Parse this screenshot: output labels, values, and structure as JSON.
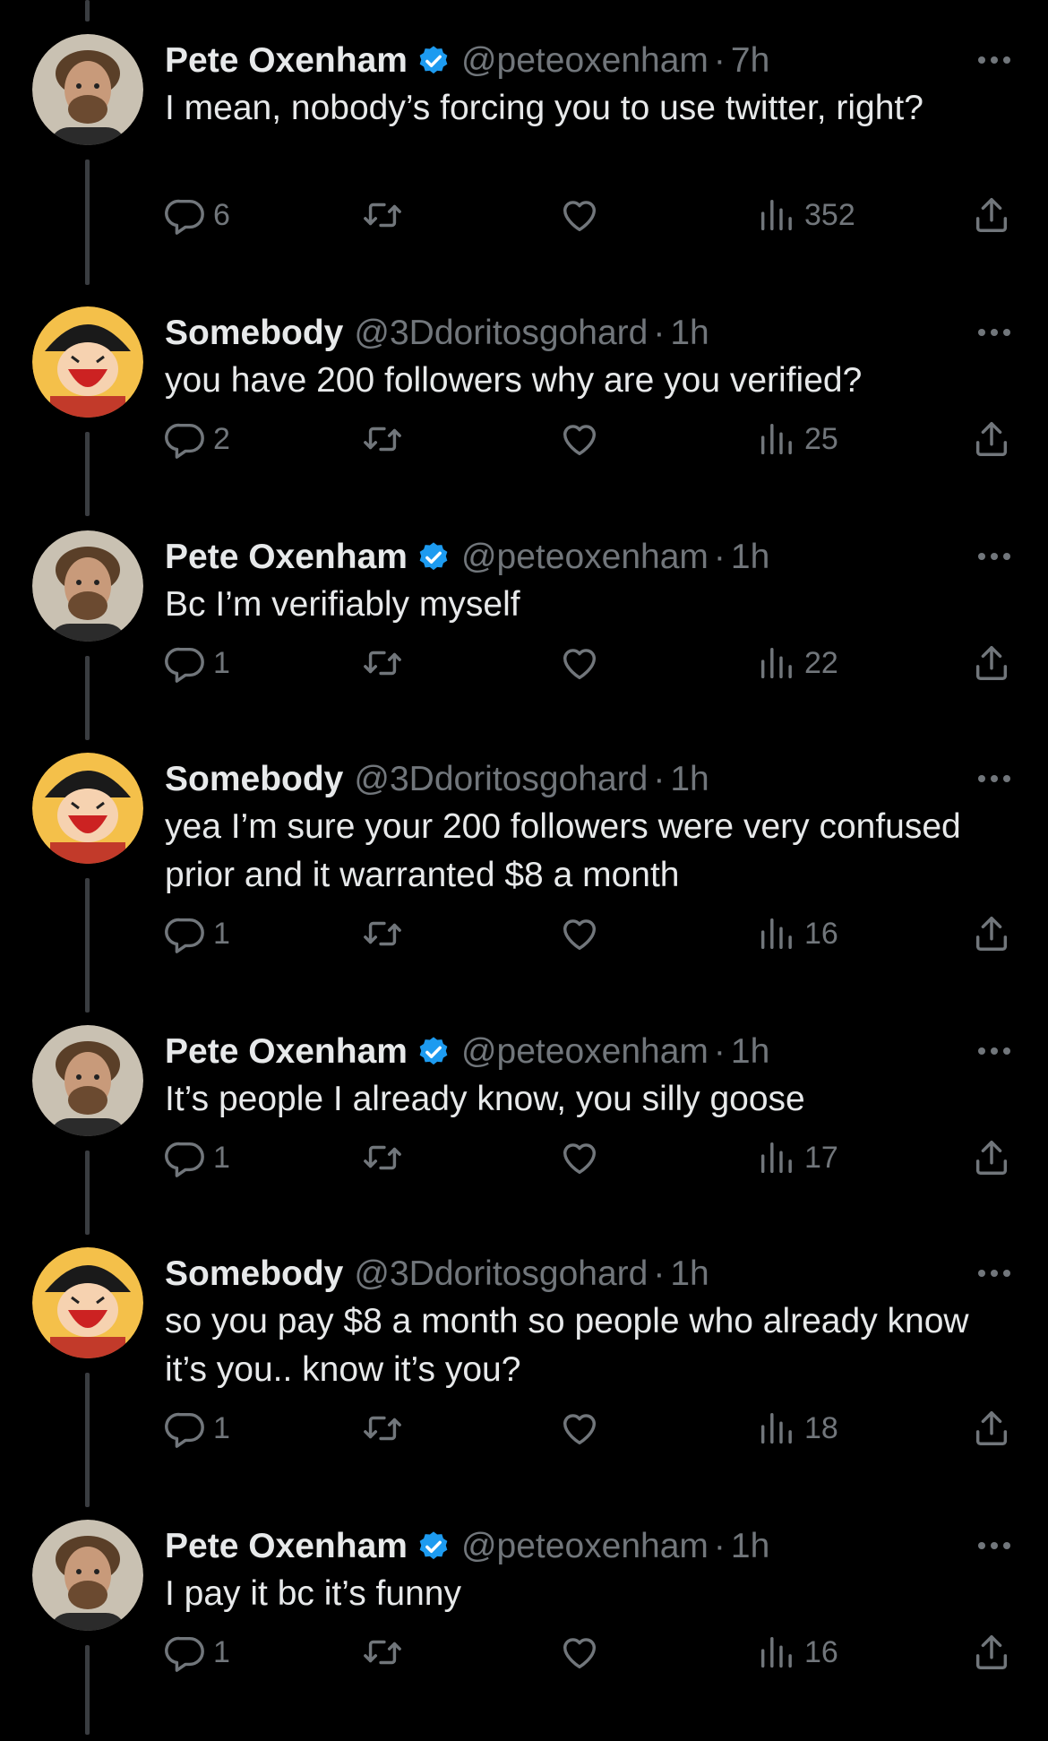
{
  "tweets": [
    {
      "name": "Pete Oxenham",
      "verified": true,
      "handle": "@peteoxenham",
      "time": "7h",
      "text": "I mean, nobody’s forcing you to use twitter, right?",
      "replies": "6",
      "views": "352",
      "avatar": "pete"
    },
    {
      "name": "Somebody",
      "verified": false,
      "handle": "@3Ddoritosgohard",
      "time": "1h",
      "text": "you have 200 followers why are you verified?",
      "replies": "2",
      "views": "25",
      "avatar": "luffy"
    },
    {
      "name": "Pete Oxenham",
      "verified": true,
      "handle": "@peteoxenham",
      "time": "1h",
      "text": "Bc I’m verifiably myself",
      "replies": "1",
      "views": "22",
      "avatar": "pete"
    },
    {
      "name": "Somebody",
      "verified": false,
      "handle": "@3Ddoritosgohard",
      "time": "1h",
      "text": "yea I’m sure your 200 followers were very confused prior and it warranted $8 a month",
      "replies": "1",
      "views": "16",
      "avatar": "luffy"
    },
    {
      "name": "Pete Oxenham",
      "verified": true,
      "handle": "@peteoxenham",
      "time": "1h",
      "text": "It’s people I already know, you silly goose",
      "replies": "1",
      "views": "17",
      "avatar": "pete"
    },
    {
      "name": "Somebody",
      "verified": false,
      "handle": "@3Ddoritosgohard",
      "time": "1h",
      "text": "so you pay $8 a month so people who already know it’s you.. know it’s you?",
      "replies": "1",
      "views": "18",
      "avatar": "luffy"
    },
    {
      "name": "Pete Oxenham",
      "verified": true,
      "handle": "@peteoxenham",
      "time": "1h",
      "text": "I pay it bc it’s funny",
      "replies": "1",
      "views": "16",
      "avatar": "pete"
    }
  ],
  "separator": "·",
  "colors": {
    "background": "#000000",
    "text": "#e7e9ea",
    "muted": "#71767b",
    "verified": "#1d9bf0",
    "thread_line": "#3a3d41"
  },
  "icons": [
    "reply-icon",
    "retweet-icon",
    "like-icon",
    "views-icon",
    "share-icon",
    "more-icon",
    "verified-icon"
  ]
}
